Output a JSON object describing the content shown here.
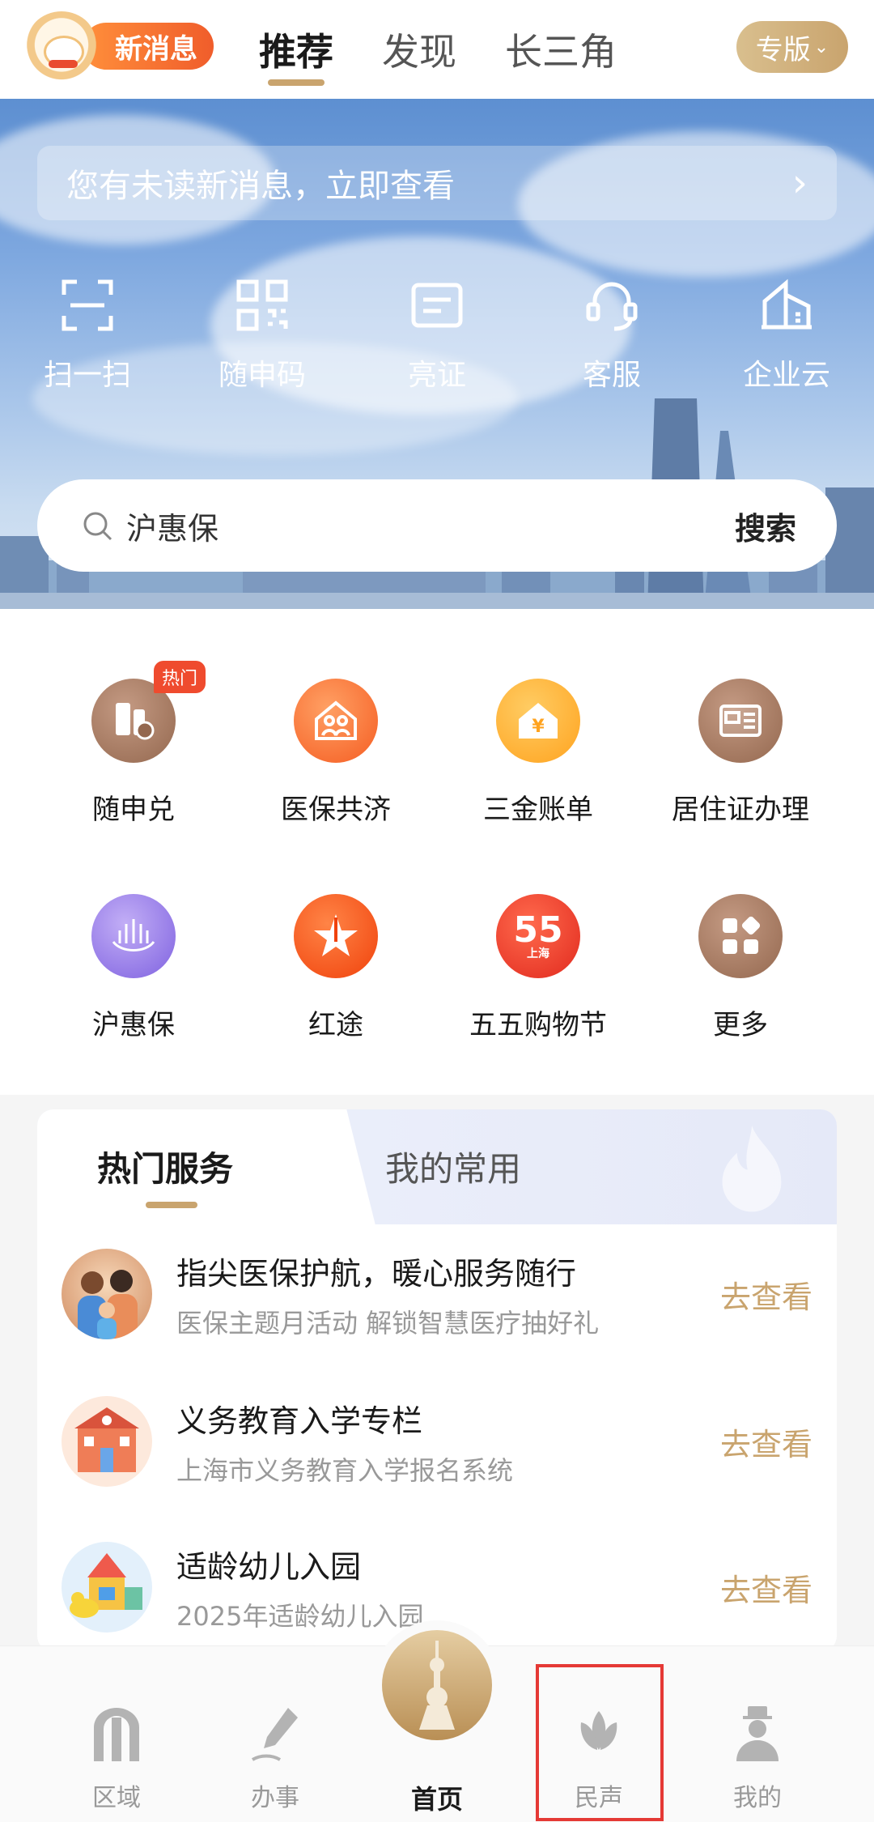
{
  "header": {
    "message_badge": "新消息",
    "tabs": [
      "推荐",
      "发现",
      "长三角"
    ],
    "active_tab": "推荐",
    "edition_button": "专版"
  },
  "hero": {
    "notice": "您有未读新消息，立即查看",
    "quick_actions": [
      {
        "label": "扫一扫",
        "icon": "scan-icon"
      },
      {
        "label": "随申码",
        "icon": "qr-code-icon"
      },
      {
        "label": "亮证",
        "icon": "id-card-icon"
      },
      {
        "label": "客服",
        "icon": "customer-service-icon"
      },
      {
        "label": "企业云",
        "icon": "building-icon"
      }
    ],
    "search": {
      "placeholder": "沪惠保",
      "button": "搜索"
    }
  },
  "service_grid": [
    {
      "label": "随申兑",
      "icon": "redeem-icon",
      "color": "#a57a63",
      "tag": "热门"
    },
    {
      "label": "医保共济",
      "icon": "family-house-icon",
      "color": "#ff7a3d"
    },
    {
      "label": "三金账单",
      "icon": "yuan-house-icon",
      "color": "#ffb23a"
    },
    {
      "label": "居住证办理",
      "icon": "residence-permit-icon",
      "color": "#a57a63"
    },
    {
      "label": "沪惠保",
      "icon": "lotus-icon",
      "color": "#9c7fe8"
    },
    {
      "label": "红途",
      "icon": "star-tower-icon",
      "color": "#ff5a1f"
    },
    {
      "label": "五五购物节",
      "icon": "shopping-festival-icon",
      "color": "#f2402f",
      "badge_text": "55",
      "badge_sub": "上海"
    },
    {
      "label": "更多",
      "icon": "grid-more-icon",
      "color": "#a57a63"
    }
  ],
  "services_card": {
    "tabs": [
      "热门服务",
      "我的常用"
    ],
    "active_tab": "热门服务",
    "items": [
      {
        "title": "指尖医保护航，暖心服务随行",
        "subtitle": "医保主题月活动 解锁智慧医疗抽好礼",
        "action": "去查看"
      },
      {
        "title": "义务教育入学专栏",
        "subtitle": "上海市义务教育入学报名系统",
        "action": "去查看"
      },
      {
        "title": "适龄幼儿入园",
        "subtitle": "2025年适龄幼儿入园",
        "action": "去查看"
      }
    ]
  },
  "bottom_nav": {
    "items": [
      "区域",
      "办事",
      "首页",
      "民声",
      "我的"
    ],
    "active": "首页"
  },
  "colors": {
    "accent_gold": "#c9a46e",
    "badge_orange": "#f05d2b",
    "highlight_red": "#e53935"
  }
}
